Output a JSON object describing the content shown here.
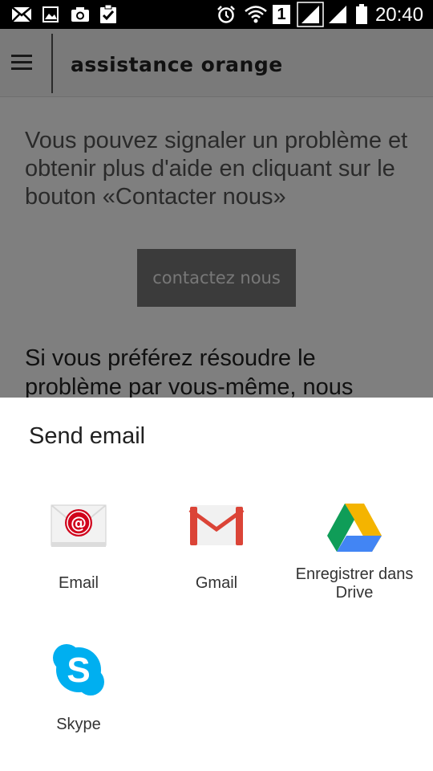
{
  "status_bar": {
    "time": "20:40",
    "sim_label": "1",
    "icons": [
      "mail-icon",
      "image-icon",
      "camera-icon",
      "clipboard-check-icon",
      "alarm-icon",
      "wifi-icon",
      "sim-icon",
      "signal-icon",
      "signal-icon",
      "battery-icon"
    ]
  },
  "app": {
    "title": "assistance orange",
    "intro": "Vous pouvez signaler un problème et obtenir plus d'aide en cliquant sur le bouton «Contacter nous»",
    "contact_button": "contactez nous",
    "selfhelp": "Si vous préférez résoudre le problème par vous-même, nous"
  },
  "sheet": {
    "title": "Send email",
    "targets": [
      {
        "label": "Email",
        "icon": "email-app-icon"
      },
      {
        "label": "Gmail",
        "icon": "gmail-icon"
      },
      {
        "label": "Enregistrer dans Drive",
        "icon": "google-drive-icon"
      },
      {
        "label": "Skype",
        "icon": "skype-icon"
      }
    ]
  },
  "colors": {
    "status_bar": "#000000",
    "scrim": "rgba(0,0,0,0.5)",
    "email_red": "#d0021b",
    "gmail_red": "#db4437",
    "drive_green": "#0f9d58",
    "drive_yellow": "#f4b400",
    "drive_blue": "#4285f4",
    "skype_blue": "#00aff0"
  }
}
